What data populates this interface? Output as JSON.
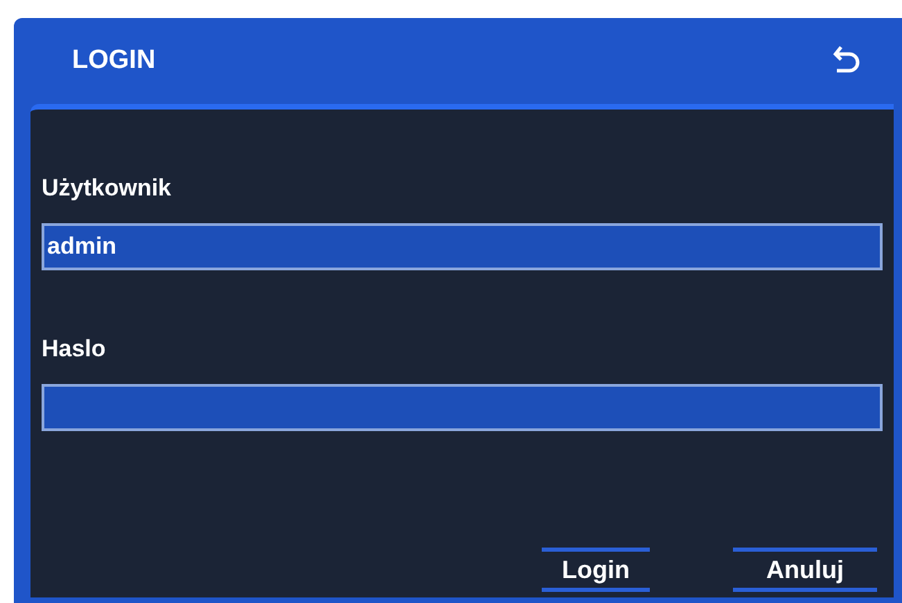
{
  "window": {
    "title": "LOGIN"
  },
  "fields": [
    {
      "label": "Użytkownik",
      "value": "admin"
    },
    {
      "label": "Haslo"
    }
  ],
  "buttons": [
    "Login",
    "Anuluj"
  ]
}
